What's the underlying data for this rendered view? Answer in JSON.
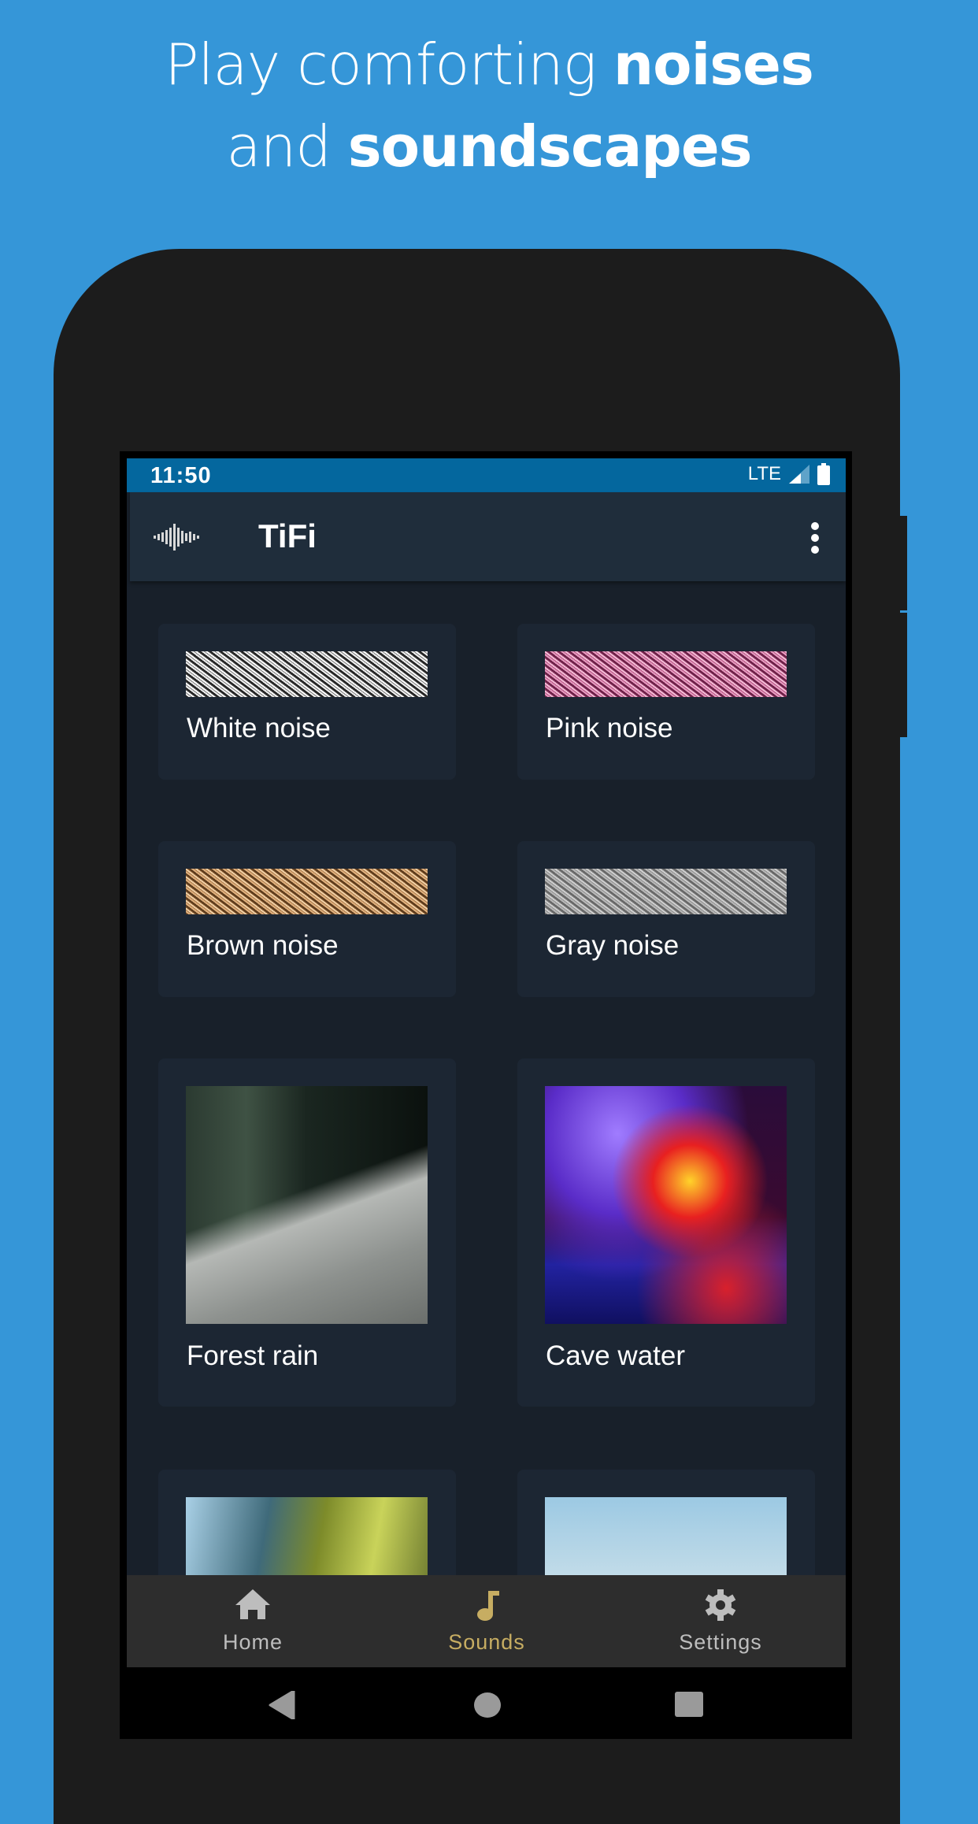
{
  "promo": {
    "line1_regular": "Play comforting ",
    "line1_bold": "noises",
    "line2_regular": "and ",
    "line2_bold": "soundscapes"
  },
  "status_bar": {
    "time": "11:50",
    "network": "LTE",
    "icons": [
      "signal-icon",
      "battery-icon"
    ]
  },
  "app_bar": {
    "logo_icon": "waveform-icon",
    "title": "TiFi",
    "menu_icon": "more-vert-icon"
  },
  "sounds": [
    {
      "label": "White noise",
      "type": "noise",
      "color": "#8a8a8a"
    },
    {
      "label": "Pink noise",
      "type": "noise",
      "color": "#b0507e"
    },
    {
      "label": "Brown noise",
      "type": "noise",
      "color": "#a8784a"
    },
    {
      "label": "Gray noise",
      "type": "noise",
      "color": "#8d8d8d"
    },
    {
      "label": "Forest rain",
      "type": "photo"
    },
    {
      "label": "Cave water",
      "type": "photo"
    },
    {
      "label": "",
      "type": "photo"
    },
    {
      "label": "",
      "type": "photo"
    }
  ],
  "bottom_nav": {
    "items": [
      {
        "label": "Home",
        "icon": "home-icon",
        "active": false
      },
      {
        "label": "Sounds",
        "icon": "music-note-icon",
        "active": true
      },
      {
        "label": "Settings",
        "icon": "gear-icon",
        "active": false
      }
    ],
    "active_color": "#c7ad62",
    "inactive_color": "#bdbdbd"
  },
  "system_nav": {
    "icons": [
      "back-icon",
      "home-circle-icon",
      "recents-icon"
    ]
  },
  "colors": {
    "background": "#3596d8",
    "status_bar": "#04679e",
    "app_bar": "#1f2d3b",
    "content": "#18202a",
    "card": "#1c2633"
  }
}
